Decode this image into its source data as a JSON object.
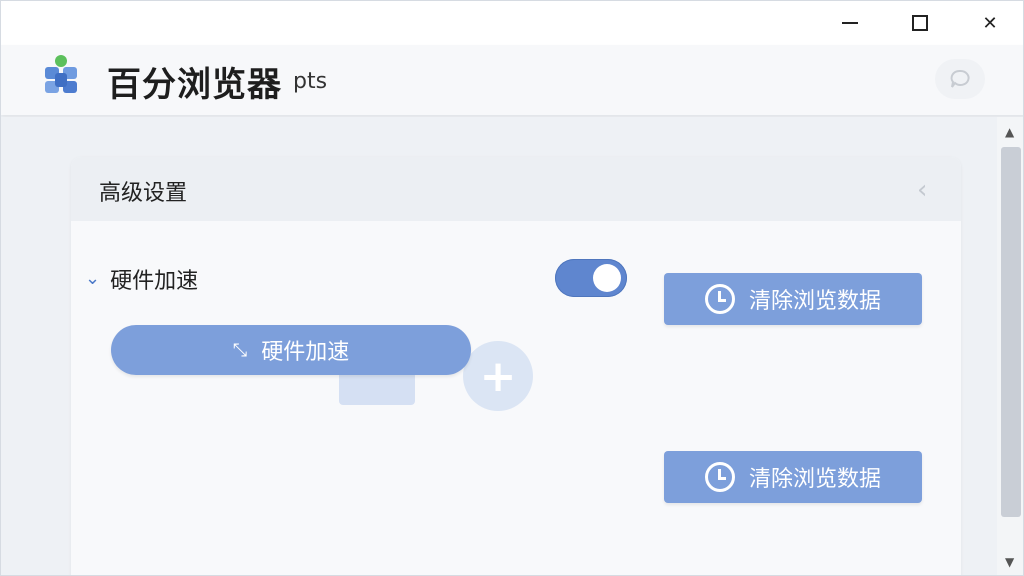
{
  "window": {
    "controls": {
      "minimize": "–",
      "maximize": "□",
      "close": "✕"
    }
  },
  "header": {
    "app_title": "百分浏览器",
    "title_suffix": "pts",
    "logo_icon": "app-logo-icon",
    "chat_icon": "chat-bubble-icon"
  },
  "panel": {
    "title": "高级设置",
    "back_icon": "chevron-left-icon"
  },
  "section": {
    "label": "硬件加速",
    "expanded": true,
    "toggle_on": true,
    "button_label": "硬件加速",
    "button_icon": "arrows-diagonal-icon"
  },
  "actions": [
    {
      "label": "清除浏览数据",
      "icon": "clock-icon"
    },
    {
      "label": "清除浏览数据",
      "icon": "clock-icon"
    }
  ],
  "colors": {
    "accent": "#7d9fdb",
    "toggle": "#5f86cf"
  }
}
